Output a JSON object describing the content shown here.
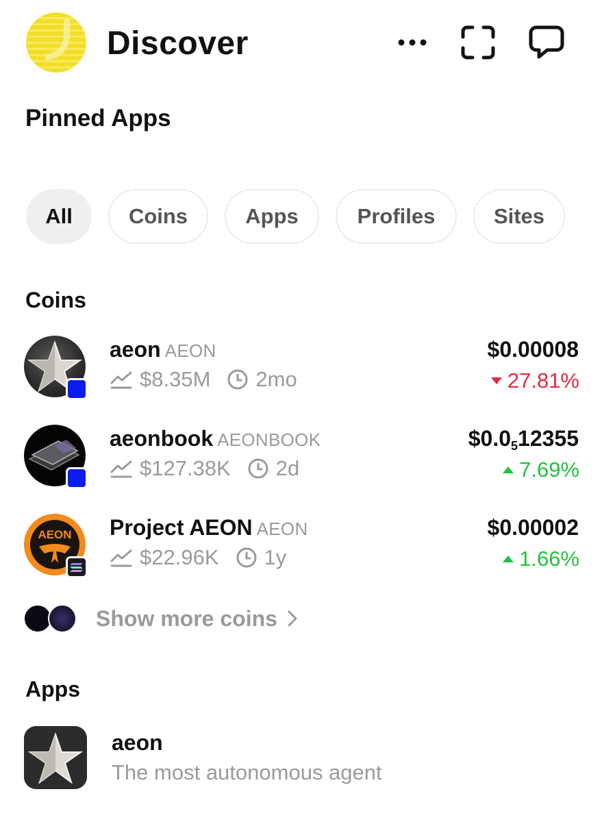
{
  "header": {
    "title": "Discover",
    "icons": [
      "more-icon",
      "scan-icon",
      "chat-icon"
    ]
  },
  "pinned_title": "Pinned Apps",
  "filters": [
    {
      "label": "All",
      "active": true
    },
    {
      "label": "Coins",
      "active": false
    },
    {
      "label": "Apps",
      "active": false
    },
    {
      "label": "Profiles",
      "active": false
    },
    {
      "label": "Sites",
      "active": false
    }
  ],
  "coins_section": {
    "title": "Coins",
    "items": [
      {
        "name": "aeon",
        "ticker": "AEON",
        "market_cap": "$8.35M",
        "age": "2mo",
        "price": "$0.00008",
        "change": "27.81%",
        "direction": "down",
        "chain": "base",
        "chain_color": "#0b1cf0"
      },
      {
        "name": "aeonbook",
        "ticker": "AEONBOOK",
        "market_cap": "$127.38K",
        "age": "2d",
        "price_main": "$0.0",
        "price_sub": "5",
        "price_tail": "12355",
        "change": "7.69%",
        "direction": "up",
        "chain": "base",
        "chain_color": "#0b1cf0"
      },
      {
        "name": "Project AEON",
        "ticker": "AEON",
        "market_cap": "$22.96K",
        "age": "1y",
        "price": "$0.00002",
        "change": "1.66%",
        "direction": "up",
        "chain": "solana",
        "chain_color": "#1a1a1a"
      }
    ],
    "show_more": "Show more coins"
  },
  "apps_section": {
    "title": "Apps",
    "items": [
      {
        "name": "aeon",
        "description": "The most autonomous agent"
      }
    ]
  },
  "colors": {
    "down": "#e5293f",
    "up": "#22c33a",
    "muted": "#9a9a9a",
    "chip_active": "#efefef"
  }
}
